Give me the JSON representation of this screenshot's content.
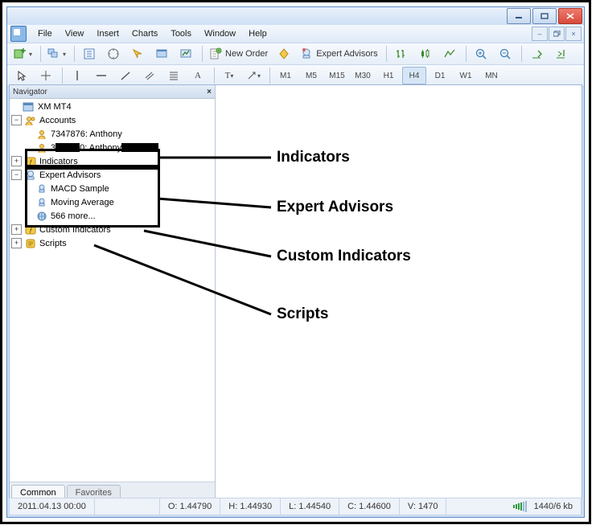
{
  "menubar": {
    "items": [
      "File",
      "View",
      "Insert",
      "Charts",
      "Tools",
      "Window",
      "Help"
    ]
  },
  "toolbar2": {
    "newOrder": "New Order",
    "expertAdvisors": "Expert Advisors"
  },
  "timeframes": [
    "M1",
    "M5",
    "M15",
    "M30",
    "H1",
    "H4",
    "D1",
    "W1",
    "MN"
  ],
  "activeTimeframe": "H4",
  "navigator": {
    "title": "Navigator",
    "root": "XM MT4",
    "accounts": {
      "label": "Accounts",
      "items": [
        {
          "num": "7347876",
          "name": "Anthony"
        },
        {
          "num_prefix": "3",
          "num_hidden_w": 30,
          "num_suffix": "0",
          "name_prefix": "Anthony",
          "name_hidden_w": 46
        }
      ]
    },
    "indicators": "Indicators",
    "expertAdvisors": {
      "label": "Expert Advisors",
      "items": [
        "MACD Sample",
        "Moving Average",
        "566 more..."
      ]
    },
    "customIndicators": "Custom Indicators",
    "scripts": "Scripts",
    "tabs": {
      "common": "Common",
      "favorites": "Favorites"
    }
  },
  "status": {
    "datetime": "2011.04.13 00:00",
    "o": "O: 1.44790",
    "h": "H: 1.44930",
    "l": "L: 1.44540",
    "c": "C: 1.44600",
    "v": "V: 1470",
    "conn": "1440/6 kb"
  },
  "annotations": {
    "indicators": "Indicators",
    "expertAdvisors": "Expert Advisors",
    "customIndicators": "Custom Indicators",
    "scripts": "Scripts"
  }
}
